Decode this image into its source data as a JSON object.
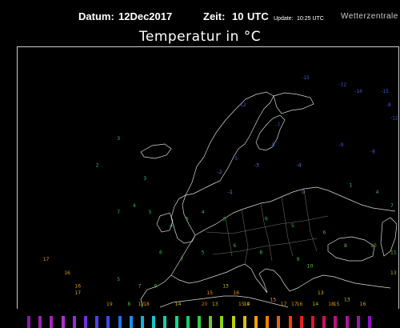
{
  "header": {
    "date_label": "Datum:",
    "date_value": "12Dec2017",
    "time_label": "Zeit:",
    "time_value": "10",
    "time_unit": "UTC",
    "update_label": "Update:",
    "update_value": "10:25 UTC",
    "brand": "Wetterzentrale",
    "title": "Temperatur in °C"
  },
  "map": {
    "stations": [
      {
        "t": "-15",
        "lon": 27,
        "lat": 73,
        "c": "#3a5bd8"
      },
      {
        "t": "-12",
        "lon": 34,
        "lat": 72,
        "c": "#3a5bd8"
      },
      {
        "t": "-16",
        "lon": 37,
        "lat": 71,
        "c": "#3a5bd8"
      },
      {
        "t": "-15",
        "lon": 42,
        "lat": 71,
        "c": "#3a5bd8"
      },
      {
        "t": "-12",
        "lon": 15,
        "lat": 69,
        "c": "#3a5bd8"
      },
      {
        "t": "-8",
        "lon": 43,
        "lat": 69,
        "c": "#3a5bd8"
      },
      {
        "t": "-12",
        "lon": 45,
        "lat": 67,
        "c": "#3a5bd8"
      },
      {
        "t": "-7",
        "lon": 22,
        "lat": 66,
        "c": "#3a5bd8"
      },
      {
        "t": "-5",
        "lon": 21,
        "lat": 63,
        "c": "#3a5bd8"
      },
      {
        "t": "-9",
        "lon": 34,
        "lat": 63,
        "c": "#3a5bd8"
      },
      {
        "t": "-5",
        "lon": 14,
        "lat": 61,
        "c": "#3a5bd8"
      },
      {
        "t": "-8",
        "lon": 40,
        "lat": 62,
        "c": "#3a5bd8"
      },
      {
        "t": "-3",
        "lon": 18,
        "lat": 60,
        "c": "#4f7fe0"
      },
      {
        "t": "-4",
        "lon": 26,
        "lat": 60,
        "c": "#4f7fe0"
      },
      {
        "t": "-2",
        "lon": 11,
        "lat": 59,
        "c": "#4f7fe0"
      },
      {
        "t": "-1",
        "lon": 13,
        "lat": 56,
        "c": "#5fa0d8"
      },
      {
        "t": "0",
        "lon": 27,
        "lat": 56,
        "c": "#5fa0d8"
      },
      {
        "t": "1",
        "lon": 36,
        "lat": 57,
        "c": "#30c090"
      },
      {
        "t": "3",
        "lon": -8,
        "lat": 64,
        "c": "#30c090"
      },
      {
        "t": "2",
        "lon": -12,
        "lat": 60,
        "c": "#30c090"
      },
      {
        "t": "3",
        "lon": -3,
        "lat": 58,
        "c": "#30c090"
      },
      {
        "t": "4",
        "lon": -5,
        "lat": 54,
        "c": "#20c060"
      },
      {
        "t": "5",
        "lon": -2,
        "lat": 53,
        "c": "#20c060"
      },
      {
        "t": "7",
        "lon": -8,
        "lat": 53,
        "c": "#20c060"
      },
      {
        "t": "4",
        "lon": 2,
        "lat": 51,
        "c": "#20c060"
      },
      {
        "t": "5",
        "lon": 5,
        "lat": 52,
        "c": "#20c060"
      },
      {
        "t": "4",
        "lon": 8,
        "lat": 53,
        "c": "#20c060"
      },
      {
        "t": "3",
        "lon": 12,
        "lat": 52,
        "c": "#20c060"
      },
      {
        "t": "6",
        "lon": 20,
        "lat": 52,
        "c": "#20c060"
      },
      {
        "t": "5",
        "lon": 25,
        "lat": 51,
        "c": "#20c060"
      },
      {
        "t": "6",
        "lon": 31,
        "lat": 50,
        "c": "#20c060"
      },
      {
        "t": "8",
        "lon": 35,
        "lat": 48,
        "c": "#40c040"
      },
      {
        "t": "10",
        "lon": 40,
        "lat": 48,
        "c": "#60c030"
      },
      {
        "t": "11",
        "lon": 44,
        "lat": 47,
        "c": "#60c030"
      },
      {
        "t": "13",
        "lon": 47,
        "lat": 44,
        "c": "#90c020"
      },
      {
        "t": "6",
        "lon": 0,
        "lat": 47,
        "c": "#20c060"
      },
      {
        "t": "7",
        "lon": 4,
        "lat": 46,
        "c": "#40c040"
      },
      {
        "t": "5",
        "lon": 8,
        "lat": 47,
        "c": "#20c060"
      },
      {
        "t": "6",
        "lon": 14,
        "lat": 48,
        "c": "#20c060"
      },
      {
        "t": "8",
        "lon": 19,
        "lat": 47,
        "c": "#40c040"
      },
      {
        "t": "9",
        "lon": 26,
        "lat": 46,
        "c": "#40c040"
      },
      {
        "t": "10",
        "lon": 28,
        "lat": 45,
        "c": "#60c030"
      },
      {
        "t": "7",
        "lon": -4,
        "lat": 42,
        "c": "#40c040"
      },
      {
        "t": "9",
        "lon": -1,
        "lat": 42,
        "c": "#40c040"
      },
      {
        "t": "5",
        "lon": -8,
        "lat": 43,
        "c": "#20c060"
      },
      {
        "t": "8",
        "lon": -6,
        "lat": 39,
        "c": "#40c040"
      },
      {
        "t": "12",
        "lon": -4,
        "lat": 37,
        "c": "#90c020"
      },
      {
        "t": "14",
        "lon": 3,
        "lat": 37,
        "c": "#c0c000"
      },
      {
        "t": "15",
        "lon": 9,
        "lat": 41,
        "c": "#e0a000"
      },
      {
        "t": "13",
        "lon": 12,
        "lat": 42,
        "c": "#c0c000"
      },
      {
        "t": "16",
        "lon": 14,
        "lat": 41,
        "c": "#e0a000"
      },
      {
        "t": "14",
        "lon": 16,
        "lat": 39,
        "c": "#c0c000"
      },
      {
        "t": "15",
        "lon": 21,
        "lat": 40,
        "c": "#e0a000"
      },
      {
        "t": "17",
        "lon": 23,
        "lat": 38,
        "c": "#e0a000"
      },
      {
        "t": "16",
        "lon": 26,
        "lat": 36,
        "c": "#e0a000"
      },
      {
        "t": "14",
        "lon": 29,
        "lat": 38,
        "c": "#c0c000"
      },
      {
        "t": "15",
        "lon": 33,
        "lat": 37,
        "c": "#e0a000"
      },
      {
        "t": "13",
        "lon": 35,
        "lat": 40,
        "c": "#c0c000"
      },
      {
        "t": "16",
        "lon": 38,
        "lat": 38,
        "c": "#e0a000"
      },
      {
        "t": "15",
        "lon": 15,
        "lat": 37,
        "c": "#e0a000"
      },
      {
        "t": "13",
        "lon": 10,
        "lat": 36,
        "c": "#c0c000"
      },
      {
        "t": "17",
        "lon": -22,
        "lat": 46,
        "c": "#e0a000"
      },
      {
        "t": "16",
        "lon": -18,
        "lat": 44,
        "c": "#e0a000"
      },
      {
        "t": "16",
        "lon": -16,
        "lat": 42,
        "c": "#e0a000"
      },
      {
        "t": "17",
        "lon": -16,
        "lat": 41,
        "c": "#e0a000"
      },
      {
        "t": "19",
        "lon": -10,
        "lat": 35,
        "c": "#e09000"
      },
      {
        "t": "18",
        "lon": -3,
        "lat": 35,
        "c": "#e09000"
      },
      {
        "t": "20",
        "lon": 8,
        "lat": 35,
        "c": "#e07000"
      },
      {
        "t": "19",
        "lon": 16,
        "lat": 34,
        "c": "#e09000"
      },
      {
        "t": "17",
        "lon": 25,
        "lat": 34,
        "c": "#e0a000"
      },
      {
        "t": "18",
        "lon": 32,
        "lat": 35,
        "c": "#e09000"
      },
      {
        "t": "7",
        "lon": 45,
        "lat": 54,
        "c": "#40c040"
      },
      {
        "t": "4",
        "lon": 41,
        "lat": 56,
        "c": "#20c060"
      },
      {
        "t": "13",
        "lon": 30,
        "lat": 41,
        "c": "#c0c000"
      }
    ],
    "legend_colors": [
      "#8a1aa0",
      "#9a20b0",
      "#aa20c0",
      "#b030d0",
      "#9030d0",
      "#7030e0",
      "#5040e8",
      "#3050e8",
      "#2070f0",
      "#1890f0",
      "#10b0e8",
      "#10c8d0",
      "#10d0b0",
      "#10d890",
      "#10d060",
      "#30d040",
      "#60d020",
      "#90d010",
      "#c0d000",
      "#e0c000",
      "#f0a000",
      "#f08000",
      "#f06000",
      "#f04000",
      "#e82020",
      "#e01040",
      "#d01060",
      "#c01080",
      "#b010a0",
      "#a010b0",
      "#9010c0"
    ]
  }
}
